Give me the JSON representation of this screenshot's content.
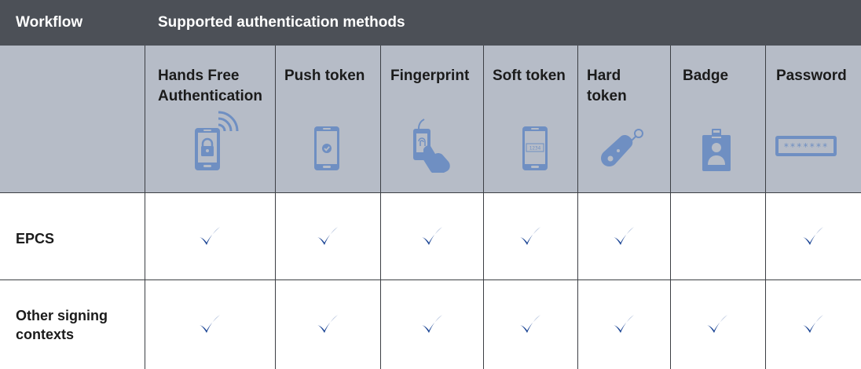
{
  "header": {
    "workflow": "Workflow",
    "supported": "Supported authentication methods"
  },
  "columns": [
    {
      "label": "Hands Free Authentication",
      "icon": "phone-lock-wireless-icon"
    },
    {
      "label": "Push token",
      "icon": "phone-check-icon"
    },
    {
      "label": "Fingerprint",
      "icon": "fingerprint-reader-icon"
    },
    {
      "label": "Soft token",
      "icon": "phone-code-icon",
      "code": "1234"
    },
    {
      "label": "Hard token",
      "icon": "key-fob-icon"
    },
    {
      "label": "Badge",
      "icon": "badge-icon"
    },
    {
      "label": "Password",
      "icon": "password-field-icon",
      "mask": "*******"
    }
  ],
  "rows": [
    {
      "label": "EPCS",
      "checks": [
        true,
        true,
        true,
        true,
        true,
        false,
        true
      ]
    },
    {
      "label": "Other signing contexts",
      "checks": [
        true,
        true,
        true,
        true,
        true,
        true,
        true
      ]
    }
  ],
  "colors": {
    "header_bg": "#4c5057",
    "subheader_bg": "#b6bcc7",
    "icon": "#6f8fc2",
    "check": "#1a4494"
  }
}
